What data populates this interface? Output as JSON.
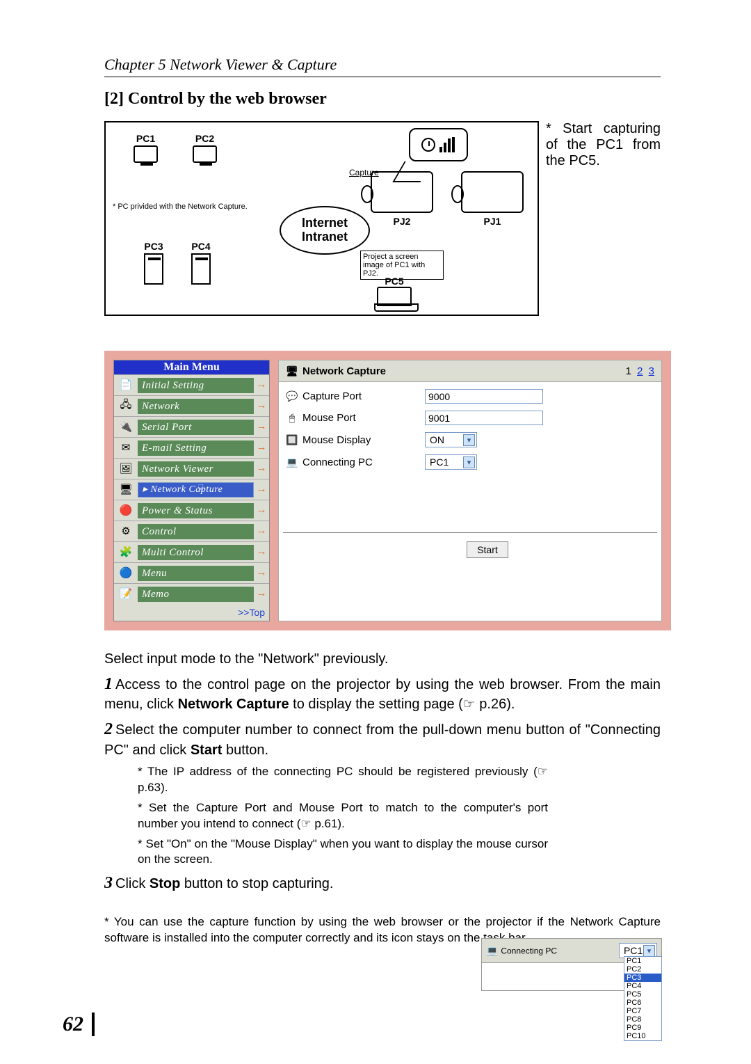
{
  "chapter": "Chapter 5 Network Viewer & Capture",
  "section_title": "[2] Control by the web browser",
  "diagram": {
    "pc1": "PC1",
    "pc2": "PC2",
    "pc3": "PC3",
    "pc4": "PC4",
    "pc5": "PC5",
    "pj1": "PJ1",
    "pj2": "PJ2",
    "note_pc": "* PC privided with the Network Capture.",
    "internet": "Internet\nIntranet",
    "proj_note": "Project a screen image of PC1 with PJ2.",
    "capture_tag": "Capture"
  },
  "side_note": "* Start capturing of the PC1 from the PC5.",
  "web": {
    "main_menu_title": "Main Menu",
    "items": [
      {
        "label": "Initial Setting",
        "ico": "📄"
      },
      {
        "label": "Network",
        "ico": "🖧"
      },
      {
        "label": "Serial Port",
        "ico": "🔌"
      },
      {
        "label": "E-mail Setting",
        "ico": "✉"
      },
      {
        "label": "Network Viewer",
        "ico": "🖼"
      },
      {
        "label": "Network Capture",
        "ico": "🖥",
        "selected": true
      },
      {
        "label": "Power & Status",
        "ico": "🔴"
      },
      {
        "label": "Control",
        "ico": "⚙"
      },
      {
        "label": "Multi Control",
        "ico": "🧩"
      },
      {
        "label": "Menu",
        "ico": "🔵"
      },
      {
        "label": "Memo",
        "ico": "📝"
      }
    ],
    "top_link": ">>Top",
    "panel_title": "Network Capture",
    "pages": [
      "1",
      "2",
      "3"
    ],
    "capture_port_label": "Capture Port",
    "capture_port_value": "9000",
    "mouse_port_label": "Mouse Port",
    "mouse_port_value": "9001",
    "mouse_display_label": "Mouse Display",
    "mouse_display_value": "ON",
    "connecting_pc_label": "Connecting PC",
    "connecting_pc_value": "PC1",
    "start_label": "Start"
  },
  "intro": "Select input mode to the \"Network\" previously.",
  "step1_a": "Access to the control page on the projector by using the web browser. From the main menu, click ",
  "step1_b": "Network Capture",
  "step1_c": " to display the setting page (☞ p.26).",
  "step2_a": "Select the computer number to connect from the pull-down menu button of \"Connecting PC\" and click ",
  "step2_b": "Start",
  "step2_c": " button.",
  "sub1": "* The IP address of the connecting PC should be registered previously (☞ p.63).",
  "sub2": "* Set the Capture Port and Mouse Port to match to the computer's port number you intend to connect (☞ p.61).",
  "sub3": "* Set \"On\" on the \"Mouse Display\" when you want to display the mouse cursor on the screen.",
  "step3_a": "Click ",
  "step3_b": "Stop",
  "step3_c": " button to stop capturing.",
  "footnote": "* You can use the capture function by using the web browser or the projector if the Network Capture software is installed into the computer correctly and its icon stays on the task bar.",
  "mini": {
    "label": "Connecting PC",
    "value": "PC1",
    "options": [
      "PC1",
      "PC2",
      "PC3",
      "PC4",
      "PC5",
      "PC6",
      "PC7",
      "PC8",
      "PC9",
      "PC10"
    ],
    "highlight": "PC3"
  },
  "page_number": "62"
}
